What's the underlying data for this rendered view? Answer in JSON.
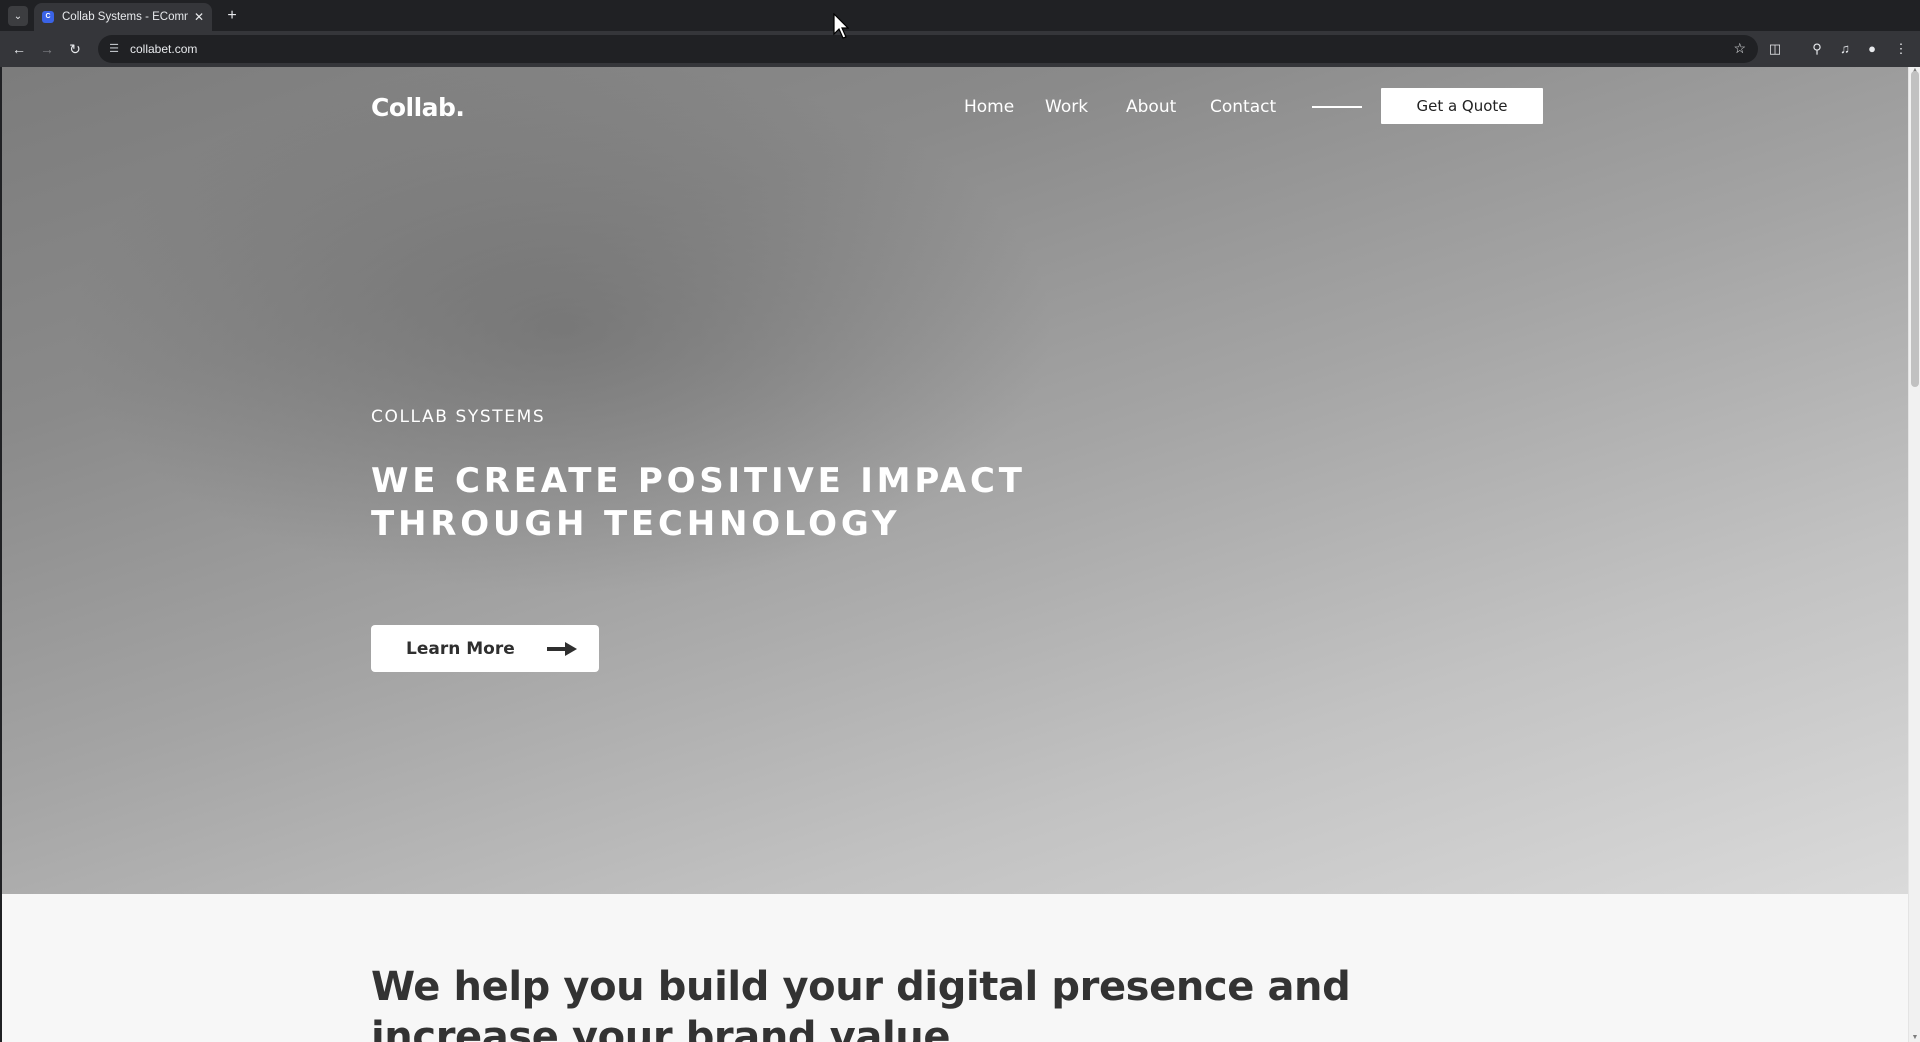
{
  "browser": {
    "tab": {
      "title": "Collab Systems - EComm",
      "favicon": "C"
    },
    "url": "collabet.com",
    "icons": {
      "tab_list": "chevron-down-icon",
      "close_tab": "close-icon",
      "new_tab": "plus-icon",
      "back": "arrow-left-icon",
      "forward": "arrow-right-icon",
      "reload": "reload-icon",
      "site_info": "tune-icon",
      "bookmark": "star-icon",
      "extensions": "puzzle-icon",
      "labs": "flask-icon",
      "media": "media-controls-icon",
      "profile": "person-icon",
      "menu": "kebab-menu-icon"
    }
  },
  "site": {
    "logo": "Collab.",
    "nav": [
      "Home",
      "Work",
      "About",
      "Contact"
    ],
    "cta": "Get a Quote",
    "hero": {
      "eyebrow": "COLLAB SYSTEMS",
      "headline": "WE CREATE POSITIVE IMPACT THROUGH TECHNOLOGY",
      "button": "Learn More"
    },
    "section": {
      "title": "We help you build your digital presence and increase your brand value"
    }
  },
  "colors": {
    "chrome_dark": "#202124",
    "chrome_toolbar": "#35363a",
    "hero_text": "#ffffff",
    "body_bg": "#f7f7f7",
    "heading_text": "#333333"
  }
}
